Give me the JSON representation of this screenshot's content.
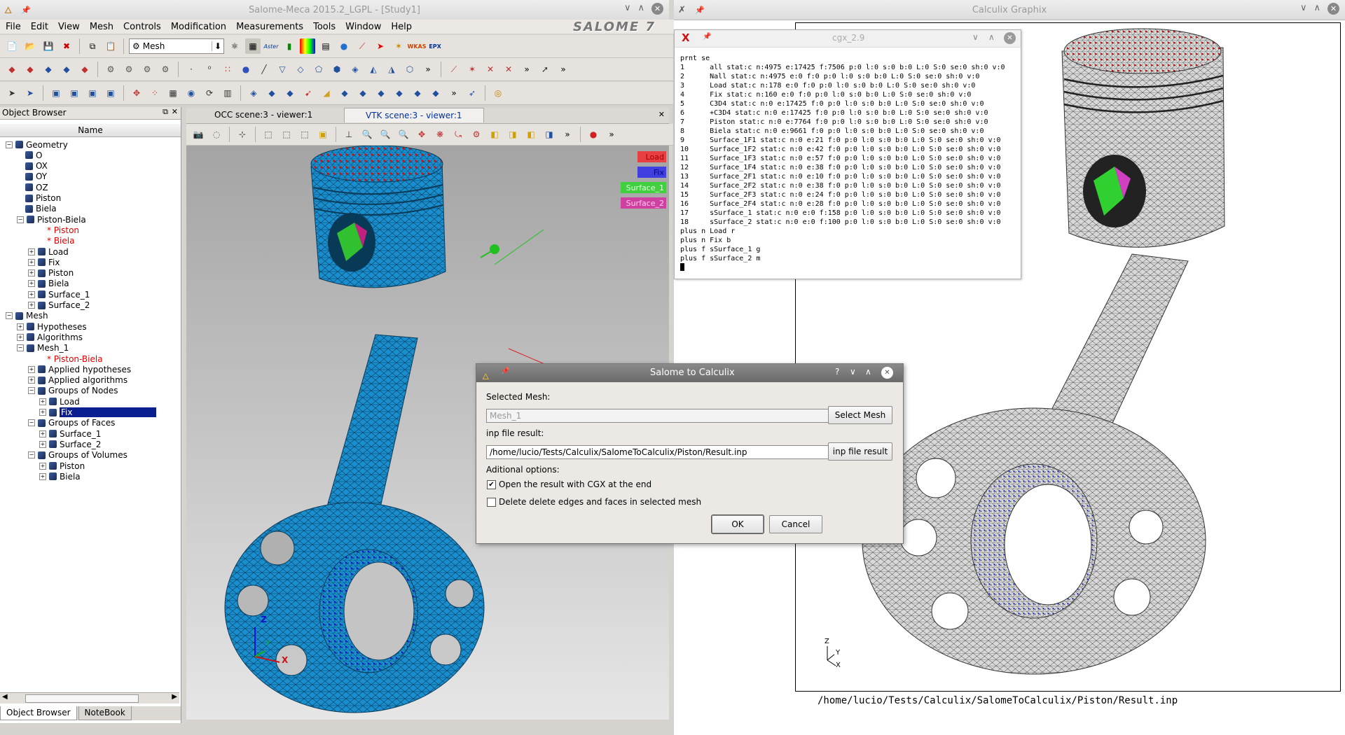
{
  "salome": {
    "title": "Salome-Meca 2015.2_LGPL - [Study1]",
    "logo": "SALOME 7",
    "menu": [
      "File",
      "Edit",
      "View",
      "Mesh",
      "Controls",
      "Modification",
      "Measurements",
      "Tools",
      "Window",
      "Help"
    ],
    "module_combo": "Mesh",
    "toolbar_labels": {
      "aster": "Aster",
      "epx": "EPX"
    },
    "object_browser": {
      "title": "Object Browser",
      "column": "Name",
      "items": [
        {
          "label": "Geometry",
          "level": 0,
          "exp": "−",
          "color": "#000"
        },
        {
          "label": "O",
          "level": 1,
          "exp": "",
          "color": "#000"
        },
        {
          "label": "OX",
          "level": 1,
          "exp": "",
          "color": "#000"
        },
        {
          "label": "OY",
          "level": 1,
          "exp": "",
          "color": "#000"
        },
        {
          "label": "OZ",
          "level": 1,
          "exp": "",
          "color": "#000"
        },
        {
          "label": "Piston",
          "level": 1,
          "exp": "",
          "color": "#000"
        },
        {
          "label": "Biela",
          "level": 1,
          "exp": "",
          "color": "#000"
        },
        {
          "label": "Piston-Biela",
          "level": 1,
          "exp": "−",
          "color": "#000"
        },
        {
          "label": "* Piston",
          "level": 2,
          "exp": "",
          "color": "#e00000"
        },
        {
          "label": "* Biela",
          "level": 2,
          "exp": "",
          "color": "#e00000"
        },
        {
          "label": "Load",
          "level": 2,
          "exp": "+",
          "color": "#000"
        },
        {
          "label": "Fix",
          "level": 2,
          "exp": "+",
          "color": "#000"
        },
        {
          "label": "Piston",
          "level": 2,
          "exp": "+",
          "color": "#000"
        },
        {
          "label": "Biela",
          "level": 2,
          "exp": "+",
          "color": "#000"
        },
        {
          "label": "Surface_1",
          "level": 2,
          "exp": "+",
          "color": "#000"
        },
        {
          "label": "Surface_2",
          "level": 2,
          "exp": "+",
          "color": "#000"
        },
        {
          "label": "Mesh",
          "level": 0,
          "exp": "−",
          "color": "#000"
        },
        {
          "label": "Hypotheses",
          "level": 1,
          "exp": "+",
          "color": "#000"
        },
        {
          "label": "Algorithms",
          "level": 1,
          "exp": "+",
          "color": "#000"
        },
        {
          "label": "Mesh_1",
          "level": 1,
          "exp": "−",
          "color": "#000"
        },
        {
          "label": "* Piston-Biela",
          "level": 2,
          "exp": "",
          "color": "#e00000"
        },
        {
          "label": "Applied hypotheses",
          "level": 2,
          "exp": "+",
          "color": "#000"
        },
        {
          "label": "Applied algorithms",
          "level": 2,
          "exp": "+",
          "color": "#000"
        },
        {
          "label": "Groups of Nodes",
          "level": 2,
          "exp": "−",
          "color": "#000"
        },
        {
          "label": "Load",
          "level": 3,
          "exp": "+",
          "color": "#000"
        },
        {
          "label": "Fix",
          "level": 3,
          "exp": "+",
          "color": "#fff",
          "selected": true
        },
        {
          "label": "Groups of Faces",
          "level": 2,
          "exp": "−",
          "color": "#000"
        },
        {
          "label": "Surface_1",
          "level": 3,
          "exp": "+",
          "color": "#000"
        },
        {
          "label": "Surface_2",
          "level": 3,
          "exp": "+",
          "color": "#000"
        },
        {
          "label": "Groups of Volumes",
          "level": 2,
          "exp": "−",
          "color": "#000"
        },
        {
          "label": "Piston",
          "level": 3,
          "exp": "+",
          "color": "#000"
        },
        {
          "label": "Biela",
          "level": 3,
          "exp": "+",
          "color": "#000"
        }
      ],
      "bottom_tabs": [
        "Object Browser",
        "NoteBook"
      ]
    },
    "viewer_tabs": [
      "OCC scene:3 - viewer:1",
      "VTK scene:3 - viewer:1"
    ],
    "legend": [
      {
        "label": "Load",
        "bg": "#e84040",
        "fg": "#a00000"
      },
      {
        "label": "Fix",
        "bg": "#4040e0",
        "fg": "#000080"
      },
      {
        "label": "Surface_1",
        "bg": "#40d040",
        "fg": "#e0ffe0"
      },
      {
        "label": "Surface_2",
        "bg": "#d040a0",
        "fg": "#ffd0f0"
      }
    ],
    "axes": {
      "x": "X",
      "y": "Y",
      "z": "Z"
    }
  },
  "cgx_window": {
    "title": "Calculix Graphix",
    "status_path": "/home/lucio/Tests/Calculix/SalomeToCalculix/Piston/Result.inp",
    "axes": {
      "x": "X",
      "y": "Y",
      "z": "Z"
    }
  },
  "terminal": {
    "title": "cgx_2.9",
    "lines": [
      "prnt se",
      "1      all stat:c n:4975 e:17425 f:7506 p:0 l:0 s:0 b:0 L:0 S:0 se:0 sh:0 v:0",
      "2      Nall stat:c n:4975 e:0 f:0 p:0 l:0 s:0 b:0 L:0 S:0 se:0 sh:0 v:0",
      "3      Load stat:c n:178 e:0 f:0 p:0 l:0 s:0 b:0 L:0 S:0 se:0 sh:0 v:0",
      "4      Fix stat:c n:160 e:0 f:0 p:0 l:0 s:0 b:0 L:0 S:0 se:0 sh:0 v:0",
      "5      C3D4 stat:c n:0 e:17425 f:0 p:0 l:0 s:0 b:0 L:0 S:0 se:0 sh:0 v:0",
      "6      +C3D4 stat:c n:0 e:17425 f:0 p:0 l:0 s:0 b:0 L:0 S:0 se:0 sh:0 v:0",
      "7      Piston stat:c n:0 e:7764 f:0 p:0 l:0 s:0 b:0 L:0 S:0 se:0 sh:0 v:0",
      "8      Biela stat:c n:0 e:9661 f:0 p:0 l:0 s:0 b:0 L:0 S:0 se:0 sh:0 v:0",
      "9      Surface_1F1 stat:c n:0 e:21 f:0 p:0 l:0 s:0 b:0 L:0 S:0 se:0 sh:0 v:0",
      "10     Surface_1F2 stat:c n:0 e:42 f:0 p:0 l:0 s:0 b:0 L:0 S:0 se:0 sh:0 v:0",
      "11     Surface_1F3 stat:c n:0 e:57 f:0 p:0 l:0 s:0 b:0 L:0 S:0 se:0 sh:0 v:0",
      "12     Surface_1F4 stat:c n:0 e:38 f:0 p:0 l:0 s:0 b:0 L:0 S:0 se:0 sh:0 v:0",
      "13     Surface_2F1 stat:c n:0 e:10 f:0 p:0 l:0 s:0 b:0 L:0 S:0 se:0 sh:0 v:0",
      "14     Surface_2F2 stat:c n:0 e:38 f:0 p:0 l:0 s:0 b:0 L:0 S:0 se:0 sh:0 v:0",
      "15     Surface_2F3 stat:c n:0 e:24 f:0 p:0 l:0 s:0 b:0 L:0 S:0 se:0 sh:0 v:0",
      "16     Surface_2F4 stat:c n:0 e:28 f:0 p:0 l:0 s:0 b:0 L:0 S:0 se:0 sh:0 v:0",
      "17     sSurface_1 stat:c n:0 e:0 f:158 p:0 l:0 s:0 b:0 L:0 S:0 se:0 sh:0 v:0",
      "18     sSurface_2 stat:c n:0 e:0 f:100 p:0 l:0 s:0 b:0 L:0 S:0 se:0 sh:0 v:0",
      "plus n Load r",
      "plus n Fix b",
      "plus f sSurface_1 g",
      "plus f sSurface_2 m"
    ]
  },
  "dialog": {
    "title": "Salome to Calculix",
    "selected_mesh_label": "Selected Mesh:",
    "mesh_value": "Mesh_1",
    "select_mesh_btn": "Select Mesh",
    "inp_label": "inp file result:",
    "inp_value": "/home/lucio/Tests/Calculix/SalomeToCalculix/Piston/Result.inp",
    "inp_btn": "inp file result",
    "options_label": "Aditional options:",
    "opt1": "Open the result with CGX at the end",
    "opt2": "Delete delete edges and faces in selected mesh",
    "ok": "OK",
    "cancel": "Cancel"
  }
}
